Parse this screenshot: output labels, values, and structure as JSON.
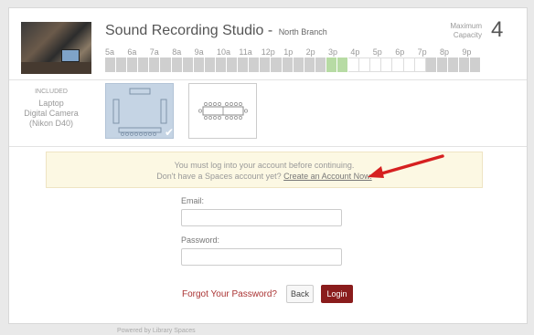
{
  "room": {
    "title": "Sound Recording Studio -",
    "branch": "North Branch",
    "capacity_label": "Maximum Capacity",
    "capacity": "4"
  },
  "schedule": {
    "times": [
      "5a",
      "6a",
      "7a",
      "8a",
      "9a",
      "10a",
      "11a",
      "12p",
      "1p",
      "2p",
      "3p",
      "4p",
      "5p",
      "6p",
      "7p",
      "8p",
      "9p"
    ],
    "slots": [
      "busy",
      "busy",
      "busy",
      "busy",
      "busy",
      "busy",
      "busy",
      "busy",
      "busy",
      "busy",
      "busy",
      "busy",
      "busy",
      "busy",
      "busy",
      "busy",
      "busy",
      "busy",
      "busy",
      "busy",
      "selected",
      "selected",
      "free",
      "free",
      "free",
      "free",
      "free",
      "free",
      "free",
      "busy",
      "busy",
      "busy",
      "busy",
      "busy"
    ]
  },
  "included": {
    "label": "INCLUDED",
    "items_line1": "Laptop",
    "items_line2": "Digital Camera",
    "items_line3": "(Nikon D40)"
  },
  "notice": {
    "line1": "You must log into your account before continuing.",
    "line2_prefix": "Don't have a Spaces account yet?",
    "link": "Create an Account Now."
  },
  "form": {
    "email_label": "Email:",
    "email_value": "",
    "password_label": "Password:",
    "password_value": "",
    "forgot": "Forgot Your Password?",
    "back": "Back",
    "login": "Login"
  },
  "footer": "Powered by Library Spaces",
  "colors": {
    "login_button": "#8a1c1c",
    "selected_slot": "#b7dba4",
    "notice_bg": "#fcf8e3",
    "arrow": "#d62020"
  }
}
